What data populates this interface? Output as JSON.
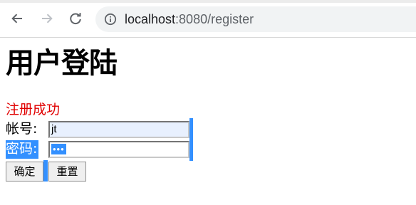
{
  "browser": {
    "url_host": "localhost",
    "url_rest": ":8080/register",
    "icons": [
      "back-arrow-icon",
      "forward-arrow-icon",
      "reload-icon",
      "site-info-icon"
    ]
  },
  "page": {
    "heading": "用户登陆",
    "status_message": "注册成功",
    "status_color": "#e00000",
    "account_label": "帐号:",
    "account_value": "jt",
    "password_label": "密码:",
    "password_value": "•••",
    "submit_label": "确定",
    "reset_label": "重置",
    "selection_color": "#3390ff"
  }
}
